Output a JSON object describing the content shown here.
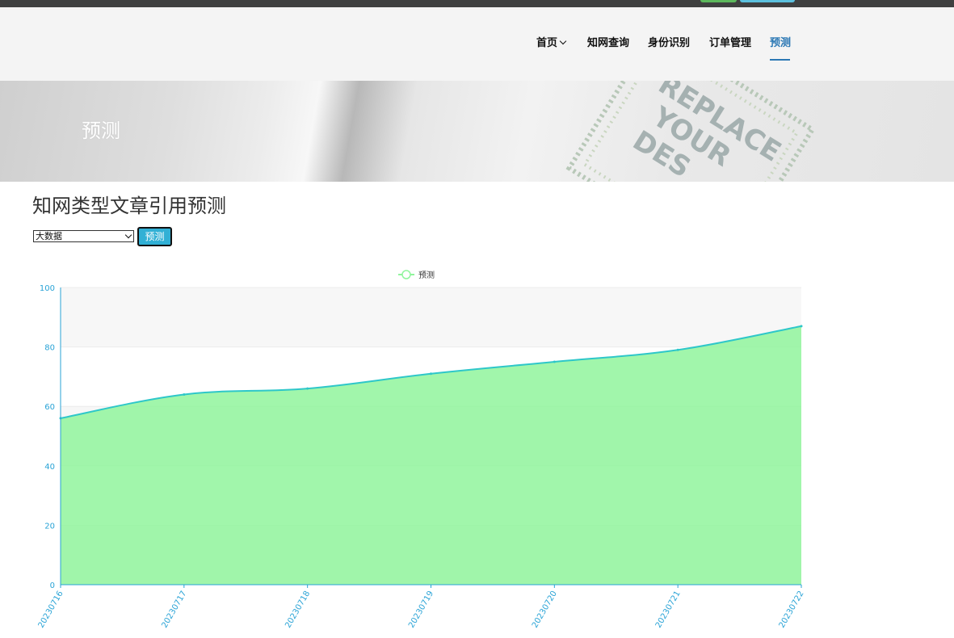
{
  "header": {
    "nav": [
      {
        "label": "首页",
        "has_dropdown": true,
        "active": false
      },
      {
        "label": "知网查询",
        "has_dropdown": false,
        "active": false
      },
      {
        "label": "身份识别",
        "has_dropdown": false,
        "active": false
      },
      {
        "label": "订单管理",
        "has_dropdown": false,
        "active": false
      },
      {
        "label": "预测",
        "has_dropdown": false,
        "active": true
      }
    ]
  },
  "banner": {
    "title": "预测",
    "stamp_text": [
      "REPLACE",
      "YOUR",
      "DES"
    ]
  },
  "main": {
    "title": "知网类型文章引用预测",
    "select": {
      "value": "大数据"
    },
    "predict_button": "预测"
  },
  "colors": {
    "line": "#2ec7c9",
    "area": "#90f59c",
    "axis": "#29a3d6",
    "nav_active": "#2b78b4",
    "button": "#31b0d5"
  },
  "chart_data": {
    "type": "area",
    "legend": [
      "预测"
    ],
    "legend_position": "top-center",
    "x": [
      "20230716",
      "20230717",
      "20230718",
      "20230719",
      "20230720",
      "20230721",
      "20230722"
    ],
    "series": [
      {
        "name": "预测",
        "values": [
          56,
          64,
          66,
          71,
          75,
          79,
          87
        ]
      }
    ],
    "ylim": [
      0,
      100
    ],
    "yticks": [
      0,
      20,
      40,
      60,
      80,
      100
    ],
    "smooth": true,
    "grid": true,
    "title": "",
    "xlabel": "",
    "ylabel": ""
  }
}
